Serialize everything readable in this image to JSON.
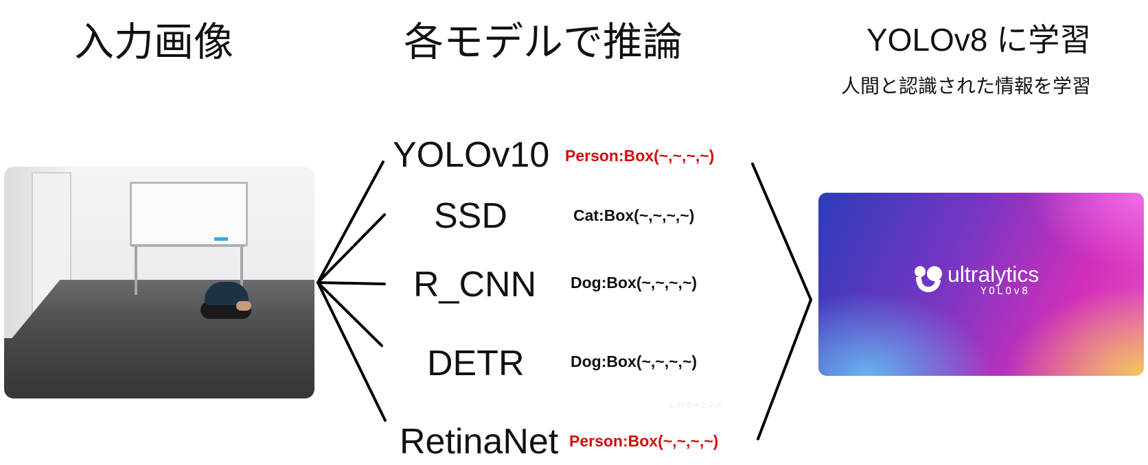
{
  "headings": {
    "input": "入力画像",
    "inference": "各モデルで推論",
    "train": "YOLOv8 に学習",
    "train_sub": "人間と認識された情報を学習"
  },
  "models": [
    {
      "name": "YOLOv10",
      "result": "Person:Box(~,~,~,~)",
      "result_color": "#d40b0b"
    },
    {
      "name": "SSD",
      "result": "Cat:Box(~,~,~,~)",
      "result_color": "#111111"
    },
    {
      "name": "R_CNN",
      "result": "Dog:Box(~,~,~,~)",
      "result_color": "#111111"
    },
    {
      "name": "DETR",
      "result": "Dog:Box(~,~,~,~)",
      "result_color": "#111111"
    },
    {
      "name": "RetinaNet",
      "result": "Person:Box(~,~,~,~)",
      "result_color": "#d40b0b"
    }
  ],
  "faint_text": "1,200 × 1,200",
  "ultralytics": {
    "logo_word": "ultralytics",
    "logo_sub": "YOLOv8"
  },
  "colors": {
    "highlight": "#d40b0b",
    "text": "#111111"
  }
}
